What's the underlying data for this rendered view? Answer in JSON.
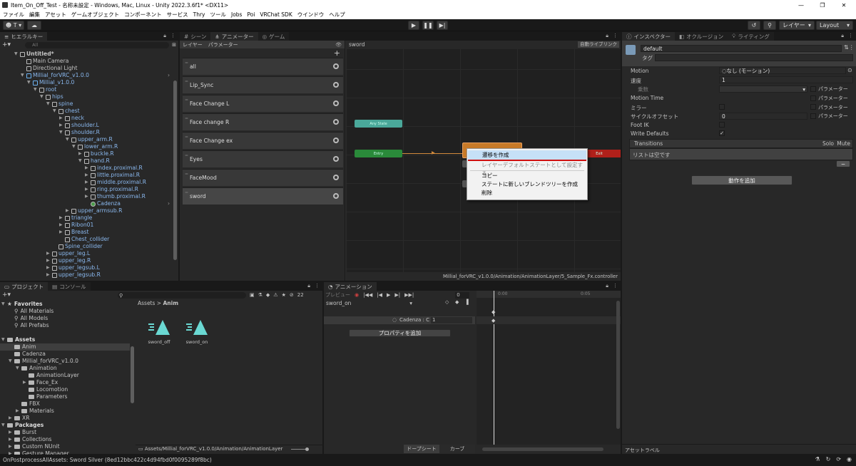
{
  "title": "Item_On_Off_Test - 名称未設定 - Windows, Mac, Linux - Unity 2022.3.6f1* <DX11>",
  "menu": [
    "ファイル",
    "編集",
    "アセット",
    "ゲームオブジェクト",
    "コンポーネント",
    "サービス",
    "Thry",
    "ツール",
    "Jobs",
    "Poi",
    "VRChat SDK",
    "ウインドウ",
    "ヘルプ"
  ],
  "toolbar": {
    "account": "T",
    "layers": "レイヤー",
    "layout": "Layout"
  },
  "hierarchy": {
    "tab": "ヒエラルキー",
    "search": "All",
    "items": [
      {
        "label": "Untitled*",
        "d": 0,
        "t": "down",
        "icon": "unity",
        "bold": true
      },
      {
        "label": "Main Camera",
        "d": 1,
        "t": "",
        "icon": "cube"
      },
      {
        "label": "Directional Light",
        "d": 1,
        "t": "",
        "icon": "cube"
      },
      {
        "label": "Millial_forVRC_v1.0.0",
        "d": 1,
        "t": "down",
        "icon": "prefab",
        "blue": true
      },
      {
        "label": "Millial_v1.0.0",
        "d": 2,
        "t": "down",
        "icon": "prefab",
        "blue": true
      },
      {
        "label": "root",
        "d": 3,
        "t": "down",
        "icon": "cube",
        "blue": true
      },
      {
        "label": "hips",
        "d": 4,
        "t": "down",
        "icon": "cube",
        "blue": true
      },
      {
        "label": "spine",
        "d": 5,
        "t": "down",
        "icon": "cube",
        "blue": true
      },
      {
        "label": "chest",
        "d": 6,
        "t": "down",
        "icon": "cube",
        "blue": true
      },
      {
        "label": "neck",
        "d": 7,
        "t": "right",
        "icon": "cube",
        "blue": true
      },
      {
        "label": "shoulder.L",
        "d": 7,
        "t": "right",
        "icon": "cube",
        "blue": true
      },
      {
        "label": "shoulder.R",
        "d": 7,
        "t": "down",
        "icon": "cube",
        "blue": true
      },
      {
        "label": "upper_arm.R",
        "d": 8,
        "t": "down",
        "icon": "cube",
        "blue": true
      },
      {
        "label": "lower_arm.R",
        "d": 9,
        "t": "down",
        "icon": "cube",
        "blue": true
      },
      {
        "label": "buckle.R",
        "d": 10,
        "t": "right",
        "icon": "cube",
        "blue": true
      },
      {
        "label": "hand.R",
        "d": 10,
        "t": "down",
        "icon": "cube",
        "blue": true
      },
      {
        "label": "index.proximal.R",
        "d": 11,
        "t": "right",
        "icon": "cube",
        "blue": true
      },
      {
        "label": "little.proximal.R",
        "d": 11,
        "t": "right",
        "icon": "cube",
        "blue": true
      },
      {
        "label": "middle.proximal.R",
        "d": 11,
        "t": "right",
        "icon": "cube",
        "blue": true
      },
      {
        "label": "ring.proximal.R",
        "d": 11,
        "t": "right",
        "icon": "cube",
        "blue": true
      },
      {
        "label": "thumb.proximal.R",
        "d": 11,
        "t": "right",
        "icon": "cube",
        "blue": true
      },
      {
        "label": "Cadenza",
        "d": 11,
        "t": "",
        "icon": "cadenza",
        "blue": true
      },
      {
        "label": "upper_armsub.R",
        "d": 8,
        "t": "right",
        "icon": "cube",
        "blue": true
      },
      {
        "label": "triangle",
        "d": 7,
        "t": "right",
        "icon": "cube",
        "blue": true
      },
      {
        "label": "Ribon01",
        "d": 7,
        "t": "right",
        "icon": "cube",
        "blue": true
      },
      {
        "label": "Breast",
        "d": 7,
        "t": "right",
        "icon": "cube",
        "blue": true
      },
      {
        "label": "Chest_collider",
        "d": 7,
        "t": "",
        "icon": "cube",
        "blue": true
      },
      {
        "label": "Spine_collider",
        "d": 6,
        "t": "",
        "icon": "cube",
        "blue": true
      },
      {
        "label": "upper_leg.L",
        "d": 5,
        "t": "right",
        "icon": "cube",
        "blue": true
      },
      {
        "label": "upper_leg.R",
        "d": 5,
        "t": "right",
        "icon": "cube",
        "blue": true
      },
      {
        "label": "upper_legsub.L",
        "d": 5,
        "t": "right",
        "icon": "cube",
        "blue": true
      },
      {
        "label": "upper_legsub.R",
        "d": 5,
        "t": "right",
        "icon": "cube",
        "blue": true
      }
    ]
  },
  "animator": {
    "tabs": [
      "シーン",
      "アニメーター",
      "ゲーム"
    ],
    "subtabs": [
      "レイヤー",
      "パラメーター"
    ],
    "breadcrumb": "sword",
    "autolive": "自動ライブリンク",
    "layers": [
      "all",
      "Lip_Sync",
      "Face Change L",
      "Face change R",
      "Face Change ex",
      "Eyes",
      "FaceMood",
      "sword"
    ],
    "path": "Millial_forVRC_v1.0.0/Animation/AnimationLayer/5_Sample_Fx.controller",
    "states": {
      "any": "Any State",
      "entry": "Entry",
      "exit": "Exit"
    }
  },
  "context": [
    "遷移を作成",
    "レイヤーデフォルトステートとして設定する",
    "コピー",
    "ステートに新しいブレンドツリーを作成",
    "削除"
  ],
  "inspector": {
    "tabs": [
      "インスペクター",
      "オクルージョン",
      "ライティング"
    ],
    "name": "default",
    "tag": "タグ",
    "motion_label": "Motion",
    "motion_val": "なし (モーション)",
    "speed_label": "速度",
    "speed_val": "1",
    "mult": "乗数",
    "param": "パラメーター",
    "mtime": "Motion Time",
    "mirror": "ミラー",
    "cycle": "サイクルオフセット",
    "cycle_val": "0",
    "footik": "Foot IK",
    "wd": "Write Defaults",
    "transitions": "Transitions",
    "solo": "Solo",
    "mute": "Mute",
    "empty": "リストは空です",
    "add": "動作を追加",
    "assetlabel": "アセットラベル"
  },
  "project": {
    "tabs": [
      "プロジェクト",
      "コンソール"
    ],
    "count": "22",
    "breadcrumb": [
      "Assets",
      "Anim"
    ],
    "tree": [
      {
        "label": "Favorites",
        "d": 0,
        "h": true,
        "t": "down",
        "star": true
      },
      {
        "label": "All Materials",
        "d": 1,
        "search": true
      },
      {
        "label": "All Models",
        "d": 1,
        "search": true
      },
      {
        "label": "All Prefabs",
        "d": 1,
        "search": true
      },
      {
        "label": "",
        "d": 0,
        "gap": true
      },
      {
        "label": "Assets",
        "d": 0,
        "h": true,
        "t": "down"
      },
      {
        "label": "Anim",
        "d": 1,
        "sel": true
      },
      {
        "label": "Cadenza",
        "d": 1
      },
      {
        "label": "Millial_forVRC_v1.0.0",
        "d": 1,
        "t": "down"
      },
      {
        "label": "Animation",
        "d": 2,
        "t": "down"
      },
      {
        "label": "AnimationLayer",
        "d": 3
      },
      {
        "label": "Face_Ex",
        "d": 3,
        "t": "right"
      },
      {
        "label": "Locomotion",
        "d": 3
      },
      {
        "label": "Parameters",
        "d": 3
      },
      {
        "label": "FBX",
        "d": 2
      },
      {
        "label": "Materials",
        "d": 2,
        "t": "right"
      },
      {
        "label": "XR",
        "d": 1,
        "t": "right"
      },
      {
        "label": "Packages",
        "d": 0,
        "h": true,
        "t": "down"
      },
      {
        "label": "Burst",
        "d": 1,
        "t": "right"
      },
      {
        "label": "Collections",
        "d": 1,
        "t": "right"
      },
      {
        "label": "Custom NUnit",
        "d": 1,
        "t": "right"
      },
      {
        "label": "Gesture Manager",
        "d": 1,
        "t": "right"
      }
    ],
    "files": [
      "sword_off",
      "sword_on"
    ],
    "path": "Assets/Millial_forVRC_v1.0.0/Animation/AnimationLayer"
  },
  "animation": {
    "tab": "アニメーション",
    "preview": "プレビュー",
    "frame": "0",
    "clip": "sword_on",
    "ticks": [
      "0:00",
      "0:05"
    ],
    "prop": "Cadenza : C",
    "prop_val": "1",
    "addprop": "プロパティを追加",
    "dope": "ドープシート",
    "curve": "カーブ"
  },
  "status": "OnPostprocessAllAssets: Sword Silver (8ed12bbc422c4d94fbd0f0095289f8bc)"
}
